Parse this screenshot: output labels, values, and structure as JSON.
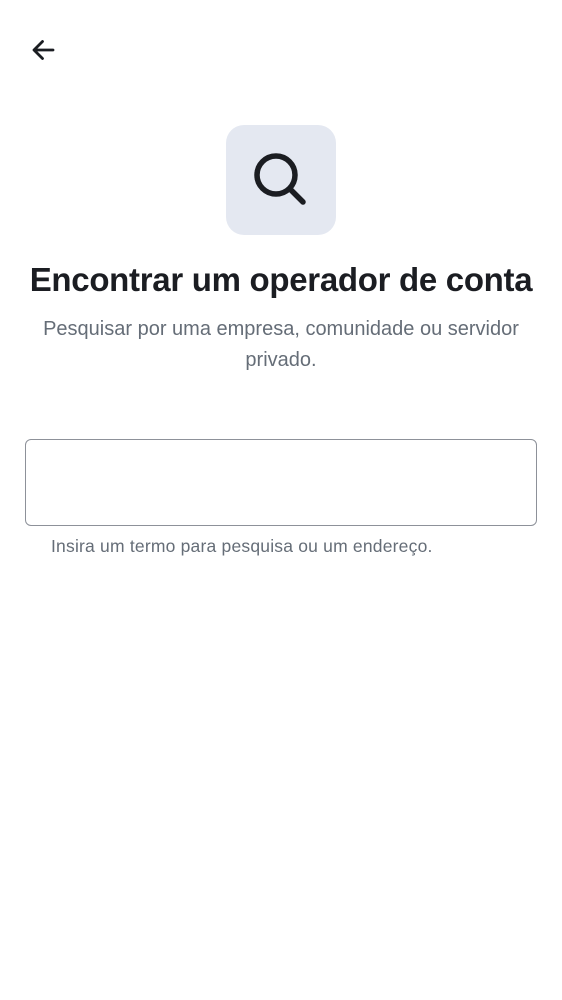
{
  "header": {
    "back_icon": "arrow-left-icon"
  },
  "hero": {
    "icon": "search-icon",
    "icon_bg_color": "#e4e8f1",
    "icon_color": "#1b1d22"
  },
  "title": "Encontrar um operador de conta",
  "subtitle": "Pesquisar por uma empresa, comunidade ou servidor privado.",
  "search": {
    "value": "",
    "helper_text": "Insira um termo para pesquisa ou um endereço."
  }
}
